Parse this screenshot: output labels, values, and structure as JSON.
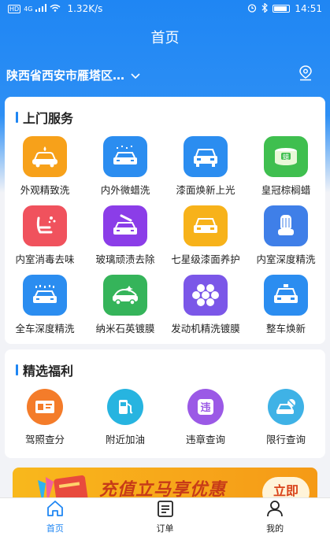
{
  "status_bar": {
    "network": "HD",
    "signal": "4G",
    "speed": "1.32K/s",
    "time": "14:51"
  },
  "header": {
    "title": "首页"
  },
  "location": {
    "text": "陕西省西安市雁塔区…"
  },
  "services": {
    "title": "上门服务",
    "items": [
      {
        "label": "外观精致洗",
        "icon": "car-wash-icon",
        "color": "#f7a11a"
      },
      {
        "label": "内外微蜡洗",
        "icon": "car-wax-icon",
        "color": "#2b8df0"
      },
      {
        "label": "漆面焕新上光",
        "icon": "car-polish-icon",
        "color": "#2b8df0"
      },
      {
        "label": "皇冠棕榈蜡",
        "icon": "wax-can-icon",
        "color": "#3fbf4f"
      },
      {
        "label": "内室消毒去味",
        "icon": "seat-disinfect-icon",
        "color": "#f0525d"
      },
      {
        "label": "玻璃顽渍去除",
        "icon": "glass-clean-icon",
        "color": "#8b3de8"
      },
      {
        "label": "七星级漆面养护",
        "icon": "paint-care-icon",
        "color": "#f7b21a"
      },
      {
        "label": "内室深度精洗",
        "icon": "seat-deep-clean-icon",
        "color": "#3f7fe8"
      },
      {
        "label": "全车深度精洗",
        "icon": "full-car-clean-icon",
        "color": "#2b8df0"
      },
      {
        "label": "纳米石英镀膜",
        "icon": "nano-coating-icon",
        "color": "#35b45a"
      },
      {
        "label": "发动机精洗镀膜",
        "icon": "engine-clean-icon",
        "color": "#7b57e8"
      },
      {
        "label": "整车焕新",
        "icon": "car-renew-icon",
        "color": "#2b8df0"
      }
    ],
    "wax_glyph": "蜡"
  },
  "benefits": {
    "title": "精选福利",
    "items": [
      {
        "label": "驾照查分",
        "icon": "license-icon",
        "color": "#f47c2a"
      },
      {
        "label": "附近加油",
        "icon": "fuel-icon",
        "color": "#27b4e0"
      },
      {
        "label": "违章查询",
        "icon": "violation-icon",
        "color": "#9b59e6"
      },
      {
        "label": "限行查询",
        "icon": "restriction-icon",
        "color": "#3fb2e6"
      }
    ],
    "violation_glyph": "违"
  },
  "banner": {
    "text": "充值立马享优惠",
    "button": "立即"
  },
  "tabbar": {
    "items": [
      {
        "label": "首页",
        "icon": "home-icon",
        "active": true
      },
      {
        "label": "订单",
        "icon": "order-icon",
        "active": false
      },
      {
        "label": "我的",
        "icon": "profile-icon",
        "active": false
      }
    ]
  }
}
